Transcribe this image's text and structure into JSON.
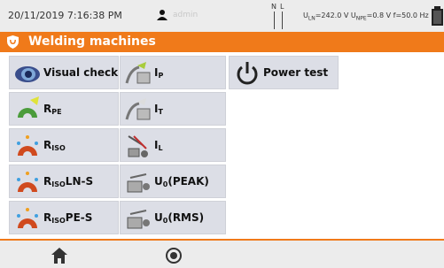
{
  "status": {
    "datetime": "20/11/2019 7:16:38 PM",
    "user": "admin",
    "n_label": "N",
    "l_label": "L",
    "uln_label": "U",
    "uln_sub": "LN",
    "uln_value": "=242.0 V",
    "upe_label": "U",
    "upe_sub": "NPE",
    "upe_value": "=0.8 V",
    "freq": "f=50.0 Hz"
  },
  "title": "Welding machines",
  "tiles": [
    {
      "main": "Visual check",
      "sub": "",
      "tail": ""
    },
    {
      "main": "I",
      "sub": "P",
      "tail": ""
    },
    {
      "main": "Power test",
      "sub": "",
      "tail": ""
    },
    {
      "main": "R",
      "sub": "PE",
      "tail": ""
    },
    {
      "main": "I",
      "sub": "T",
      "tail": ""
    },
    {
      "main": "R",
      "sub": "ISO",
      "tail": ""
    },
    {
      "main": "I",
      "sub": "L",
      "tail": ""
    },
    {
      "main": "R",
      "sub": "ISO",
      "tail": " LN-S"
    },
    {
      "main": "U",
      "sub": "0",
      "tail": " (PEAK)"
    },
    {
      "main": "R",
      "sub": "ISO",
      "tail": " PE-S"
    },
    {
      "main": "U",
      "sub": "0",
      "tail": " (RMS)"
    }
  ],
  "icons": {
    "user": "user-icon",
    "battery": "battery-icon",
    "title": "shield-icon",
    "home": "home-icon",
    "back": "back-icon"
  },
  "colors": {
    "accent": "#f07a1a",
    "tile": "#dcdee6",
    "statusbar": "#ececec"
  }
}
